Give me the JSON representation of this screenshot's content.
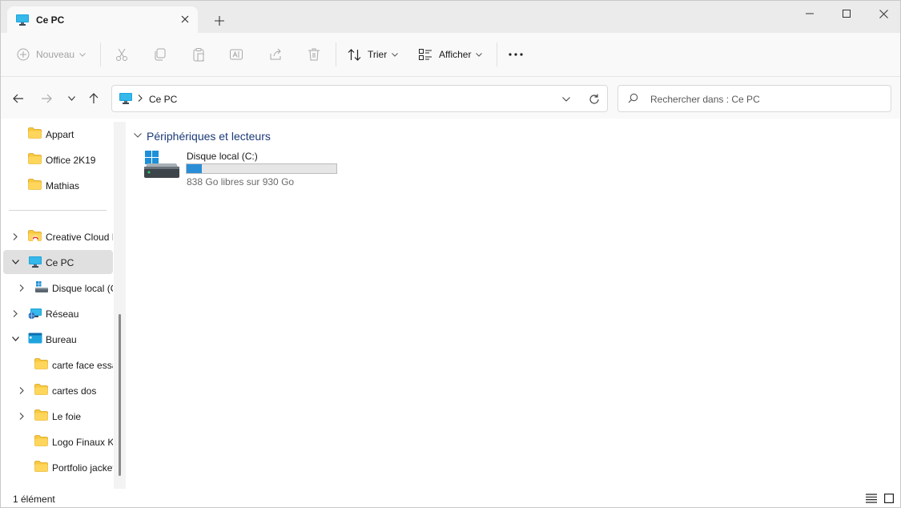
{
  "tab": {
    "title": "Ce PC"
  },
  "window_controls": [
    "minimize",
    "maximize",
    "close"
  ],
  "toolbar": {
    "new_label": "Nouveau",
    "sort_label": "Trier",
    "view_label": "Afficher",
    "more_label": "..."
  },
  "address": {
    "crumb": "Ce PC",
    "search_placeholder": "Rechercher dans : Ce PC"
  },
  "sidebar": {
    "items": [
      {
        "label": "Appart"
      },
      {
        "label": "Office 2K19"
      },
      {
        "label": "Mathias"
      },
      {
        "label": "Creative Cloud Files"
      },
      {
        "label": "Ce PC"
      },
      {
        "label": "Disque local (C:)"
      },
      {
        "label": "Réseau"
      },
      {
        "label": "Bureau"
      },
      {
        "label": "carte face essai"
      },
      {
        "label": "cartes dos"
      },
      {
        "label": "Le foie"
      },
      {
        "label": "Logo Finaux K"
      },
      {
        "label": "Portfolio jacket"
      }
    ]
  },
  "main": {
    "group_title": "Périphériques et lecteurs",
    "drive": {
      "name": "Disque local (C:)",
      "free_text": "838 Go libres sur 930 Go",
      "used_fraction": 0.099
    }
  },
  "status": {
    "count": "1 élément"
  },
  "colors": {
    "accent": "#2a8ed7",
    "folder": "#f8c93f",
    "group_title": "#1b3a78"
  }
}
